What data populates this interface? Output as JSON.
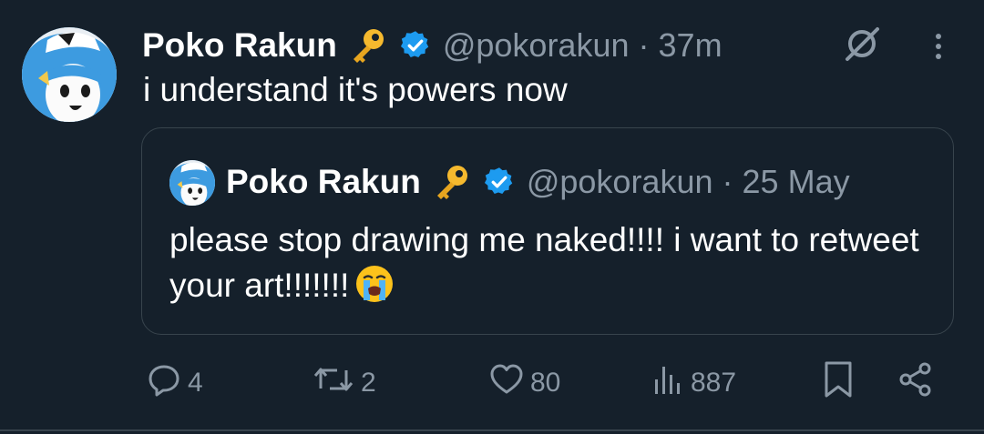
{
  "post": {
    "author_name": "Poko Rakun",
    "author_handle": "@pokorakun",
    "timestamp": "37m",
    "separator": "·",
    "text": "i understand it's powers now"
  },
  "quoted": {
    "author_name": "Poko Rakun",
    "author_handle": "@pokorakun",
    "timestamp": "25 May",
    "separator": "·",
    "text": "please stop drawing me naked!!!! i want to retweet your art!!!!!!!"
  },
  "actions": {
    "replies": "4",
    "reposts": "2",
    "likes": "80",
    "views": "887"
  },
  "icons": {
    "name_badge": "key-icon",
    "verified": "verified-badge-icon",
    "grok": "grok-icon",
    "more": "more-options-icon",
    "quoted_emoji": "loudly-crying-face-emoji"
  },
  "colors": {
    "background": "#15202b",
    "secondary_text": "#8b98a5",
    "verified_blue": "#1d9bf0",
    "border": "#38444d"
  }
}
